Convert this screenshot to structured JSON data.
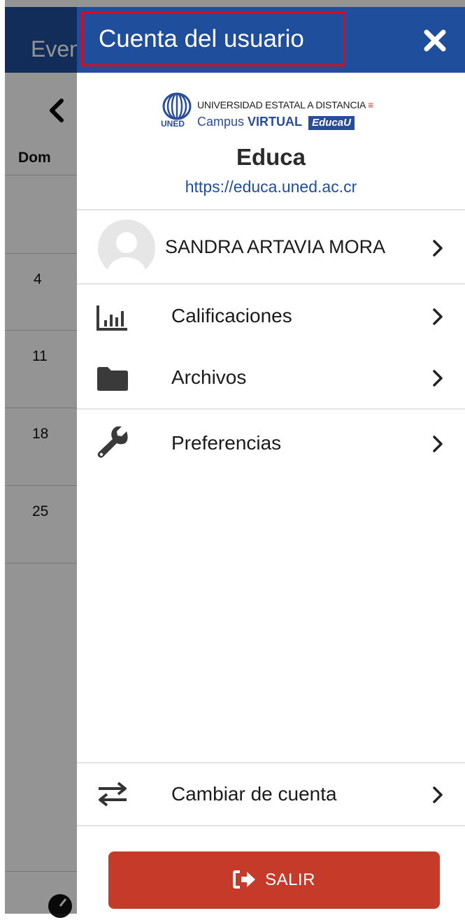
{
  "background": {
    "title": "Eventos",
    "day_of_week": "Dom",
    "days": [
      "4",
      "11",
      "18",
      "25"
    ]
  },
  "drawer": {
    "title": "Cuenta del usuario",
    "close_icon": "close-icon",
    "logo": {
      "line1": "UNIVERSIDAD ESTATAL A DISTANCIA",
      "line2_a": "Campus",
      "line2_b": "VIRTUAL",
      "badge": "EducaU",
      "acronym": "UNED"
    },
    "site_name": "Educa",
    "site_url": "https://educa.uned.ac.cr",
    "user_name": "SANDRA ARTAVIA MORA",
    "menu": [
      {
        "label": "Calificaciones",
        "icon": "grades-chart-icon"
      },
      {
        "label": "Archivos",
        "icon": "folder-icon"
      },
      {
        "label": "Preferencias",
        "icon": "wrench-icon"
      }
    ],
    "switch_account": {
      "label": "Cambiar de cuenta",
      "icon": "swap-arrows-icon"
    },
    "logout": {
      "label": "SALIR",
      "icon": "sign-out-icon"
    }
  },
  "colors": {
    "header": "#1f4e9c",
    "highlight_border": "#e30613",
    "logout_button": "#c63a2a"
  }
}
